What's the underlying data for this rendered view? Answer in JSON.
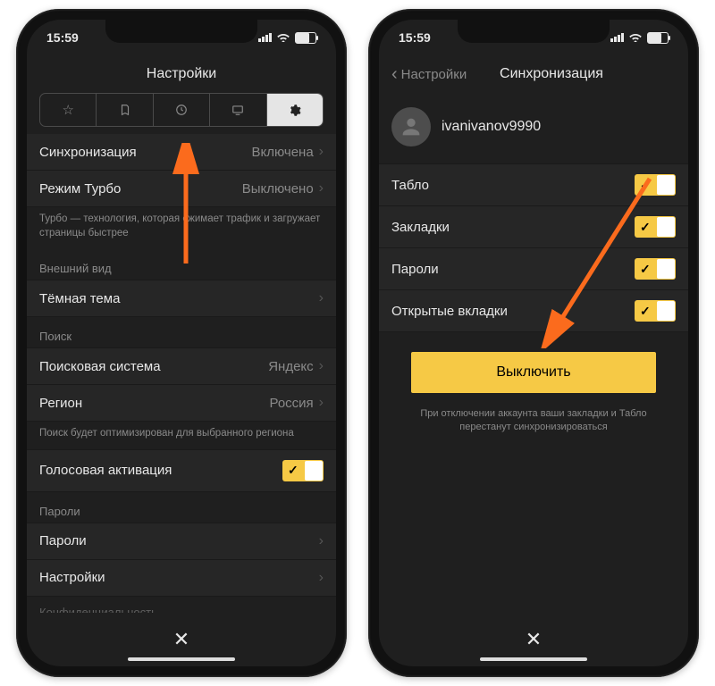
{
  "status": {
    "time": "15:59"
  },
  "left": {
    "title": "Настройки",
    "sync": {
      "label": "Синхронизация",
      "value": "Включена"
    },
    "turbo": {
      "label": "Режим Турбо",
      "value": "Выключено",
      "desc": "Турбо — технология, которая сжимает трафик и загружает страницы быстрее"
    },
    "appearance_header": "Внешний вид",
    "dark": {
      "label": "Тёмная тема"
    },
    "search_header": "Поиск",
    "engine": {
      "label": "Поисковая система",
      "value": "Яндекс"
    },
    "region": {
      "label": "Регион",
      "value": "Россия",
      "desc": "Поиск будет оптимизирован для выбранного региона"
    },
    "voice": {
      "label": "Голосовая активация"
    },
    "passwords_header": "Пароли",
    "passwords": {
      "label": "Пароли"
    },
    "settings2": {
      "label": "Настройки"
    },
    "privacy": {
      "label": "Конфиденциальность"
    }
  },
  "right": {
    "back": "Настройки",
    "title": "Синхронизация",
    "username": "ivanivanov9990",
    "items": [
      {
        "label": "Табло"
      },
      {
        "label": "Закладки"
      },
      {
        "label": "Пароли"
      },
      {
        "label": "Открытые вкладки"
      }
    ],
    "button": "Выключить",
    "note": "При отключении аккаунта ваши закладки и Табло перестанут синхронизироваться"
  }
}
